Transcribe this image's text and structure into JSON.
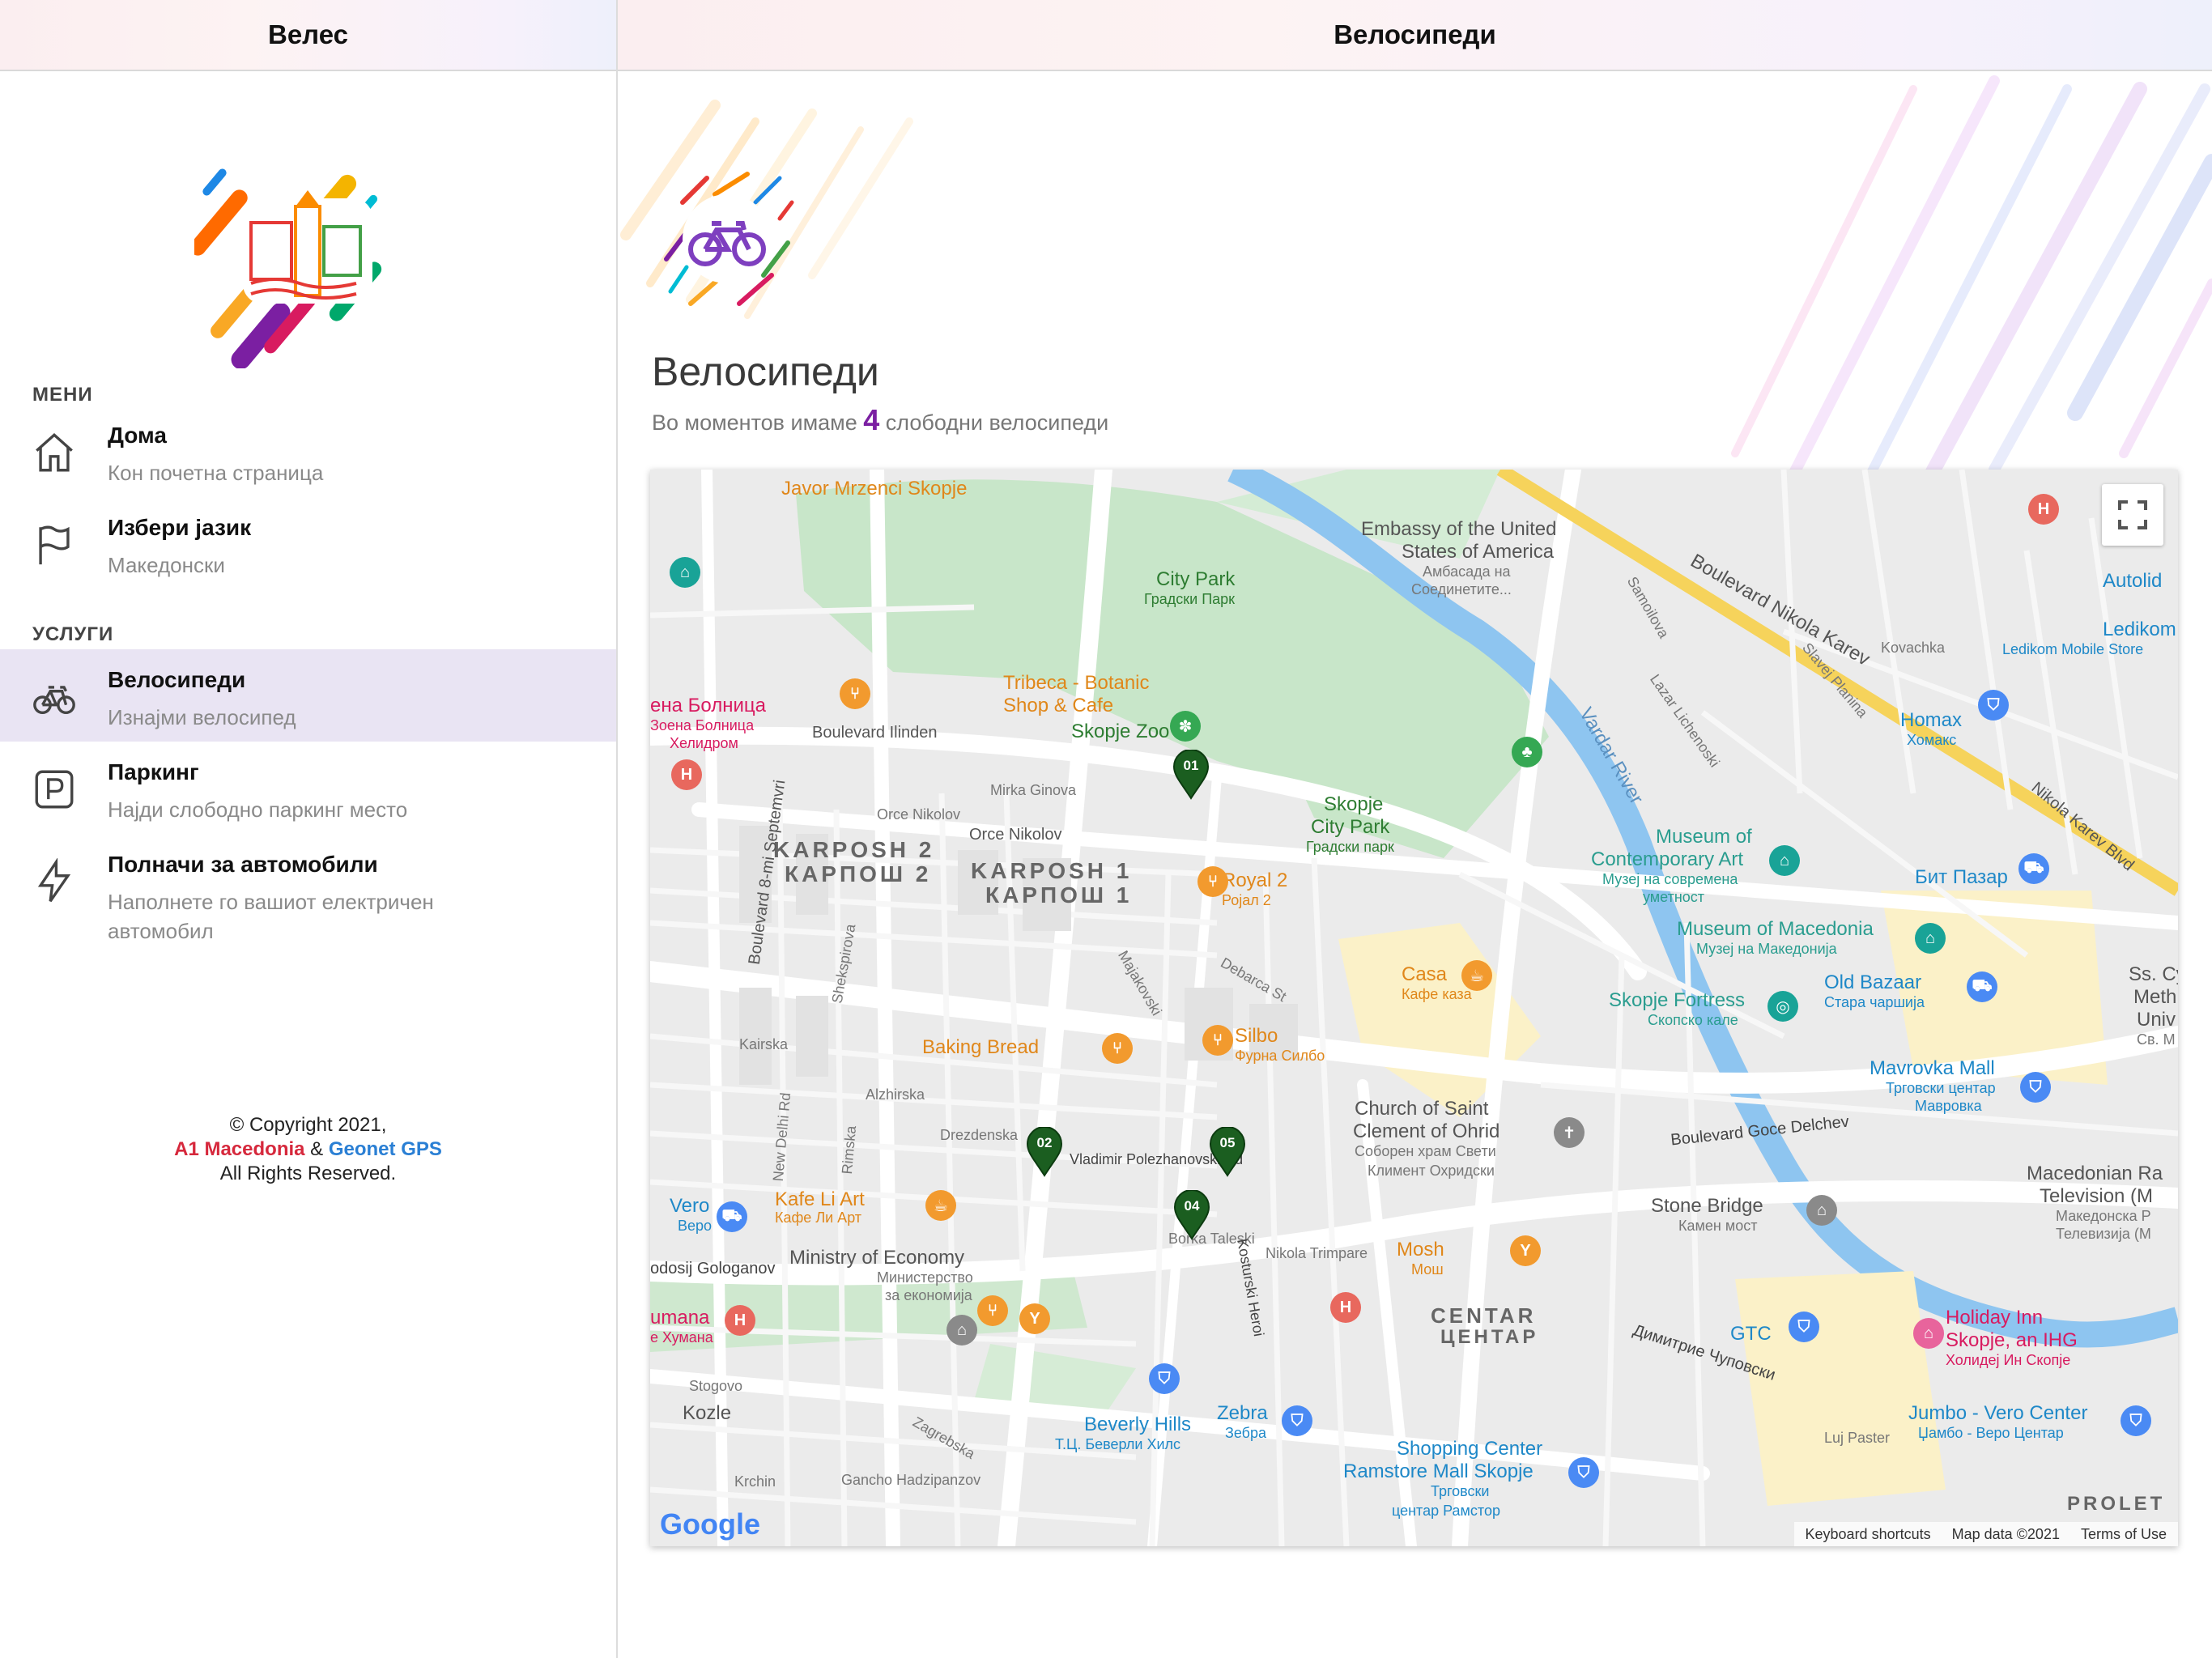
{
  "header": {
    "left_title": "Велес",
    "right_title": "Велосипеди"
  },
  "sidebar": {
    "menu_label": "МЕНИ",
    "services_label": "УСЛУГИ",
    "items": [
      {
        "title": "Дома",
        "subtitle": "Кон почетна страница",
        "icon": "home-icon"
      },
      {
        "title": "Избери јазик",
        "subtitle": "Македонски",
        "icon": "flag-icon"
      },
      {
        "title": "Велосипеди",
        "subtitle": "Изнајми велосипед",
        "icon": "bicycle-icon"
      },
      {
        "title": "Паркинг",
        "subtitle": "Најди слободно паркинг место",
        "icon": "parking-icon"
      },
      {
        "title": "Полначи за автомобили",
        "subtitle": "Наполнете го вашиот електричен автомобил",
        "icon": "lightning-icon"
      }
    ],
    "copyright_line1": "© Copyright 2021,",
    "copyright_a1": "A1 Macedonia",
    "copyright_amp": " & ",
    "copyright_geonet": "Geonet GPS",
    "copyright_line3": "All Rights Reserved."
  },
  "main": {
    "title": "Велосипеди",
    "subtitle_prefix": "Во моментов имаме ",
    "available_count": "4",
    "subtitle_suffix": " слободни велосипеди"
  },
  "map": {
    "markers": [
      "01",
      "02",
      "04",
      "05"
    ],
    "labels": {
      "javor": "Javor Mrzenci Skopje",
      "embassy1": "Embassy of the United",
      "embassy2": "States of America",
      "embassy3": "Амбасада на",
      "embassy4": "Соединетите...",
      "citypark": "City Park",
      "citypark_mk": "Градски Парк",
      "tribeca1": "Tribeca - Botanic",
      "tribeca2": "Shop & Cafe",
      "zoo": "Skopje Zoo",
      "hospital1": "ена Болница",
      "hospital2": "Зоена Болница",
      "hospital3": "Хелидром",
      "ilinden": "Boulevard Ilinden",
      "mirka": "Mirka Ginova",
      "orce1": "Orce Nikolov",
      "orce2": "Orce Nikolov",
      "karposh2": "KARPOSH 2",
      "karposh2_mk": "КАРПОШ 2",
      "karposh1": "KARPOSH 1",
      "karposh1_mk": "КАРПОШ 1",
      "skopjepark1": "Skopje",
      "skopjepark2": "City Park",
      "skopjepark3": "Градски парк",
      "royal": "Royal 2",
      "royal_mk": "Ројал 2",
      "casa": "Casa",
      "casa_mk": "Кафе каза",
      "silbo": "Silbo",
      "silbo_mk": "Фурна Силбо",
      "baking": "Baking Bread",
      "kairska": "Kairska",
      "alzhirska": "Alzhirska",
      "drezdenska": "Drezdenska",
      "vladimir": "Vladimir Polezhanovski Rd",
      "borka": "Borka Taleski",
      "trimpare": "Nikola Trimpare",
      "church1": "Church of Saint",
      "church2": "Clement of Ohrid",
      "church3": "Соборен храм Свети",
      "church4": "Климент Охридски",
      "kafeli": "Kafe Li Art",
      "kafeli_mk": "Кафе Ли Арт",
      "vero": "Vero",
      "vero_mk": "Веро",
      "moe1": "Ministry of Economy",
      "moe2": "Министерство",
      "moe3": "за економија",
      "gologanov": "odosij Gologanov",
      "mosh": "Mosh",
      "mosh_mk": "Мош",
      "centar": "CENTAR",
      "centar_mk": "ЦЕНТАР",
      "humana": "umana",
      "humana_mk": "е Хумана",
      "beverly": "Beverly Hills",
      "beverly_mk": "Т.Ц. Беверли Хилс",
      "zebra": "Zebra",
      "zebra_mk": "Зебра",
      "ramstore1": "Shopping Center",
      "ramstore2": "Ramstore Mall Skopje",
      "ramstore3": "Трговски",
      "ramstore4": "центар Рамстор",
      "kozle": "Kozle",
      "stogovo": "Stogovo",
      "zagrebska": "Zagrebska",
      "krchin": "Krchin",
      "gancho": "Gancho Hadzipanzov",
      "nikolakarev": "Boulevard Nikola Karev",
      "nikolakarev2": "Nikola Karev Blvd",
      "samoilova": "Samoilova",
      "lazar": "Lazar Lichenoski",
      "vardar": "Vardar River",
      "moca1": "Museum of",
      "moca2": "Contemporary Art",
      "moca3": "Музеј на современа",
      "moca4": "уметност",
      "momk1": "Museum of Macedonia",
      "momk2": "Музеј на Македонија",
      "fortress": "Skopje Fortress",
      "fortress_mk": "Скопско кале",
      "oldbazaar": "Old Bazaar",
      "oldbazaar_mk": "Стара чаршија",
      "bitpazar": "Бит Пазар",
      "homax": "Homax",
      "homax_mk": "Хомакс",
      "ledikom": "Ledikom",
      "ledikom2": "Ledikom Mobile Store",
      "autolid": "Autolid",
      "mavrovka": "Mavrovka Mall",
      "mavrovka_mk1": "Трговски центар",
      "mavrovka_mk2": "Мавровка",
      "goce": "Boulevard Goce Delchev",
      "stonebridge": "Stone Bridge",
      "stonebridge_mk": "Камен мост",
      "mrt1": "Macedonian Ra",
      "mrt2": "Television (M",
      "mrt3": "Македонска Р",
      "mrt4": "Телевизија (М",
      "gtc": "GTC",
      "holiday1": "Holiday Inn",
      "holiday2": "Skopje, an IHG",
      "holiday3": "Холидеј Ин Скопје",
      "chupovski": "Димитрие Чуповски",
      "jumbo1": "Jumbo - Vero Center",
      "jumbo2": "Џамбо - Веро Центар",
      "proleter": "PROLET",
      "sekspir": "Shekspirova",
      "boul8": "Boulevard 8-mi Septemvri",
      "newdelhi": "New Delhi Rd",
      "rimska": "Rimska",
      "ssmeth": "Ss. Cy",
      "ssmeth2": "Meth",
      "ssmeth3": "Univ",
      "ssmeth4": "Св. М",
      "kovachka": "Kovachka",
      "slavejplanina": "Slavej Planina",
      "luj": "Luj Paster",
      "kosturski": "Kosturski Heroi",
      "majakovski": "Majakovski",
      "debarca": "Debarca St",
      "terms1": "Keyboard shortcuts",
      "terms2": "Map data ©2021",
      "terms3": "Terms of Use",
      "google": "Google"
    }
  }
}
